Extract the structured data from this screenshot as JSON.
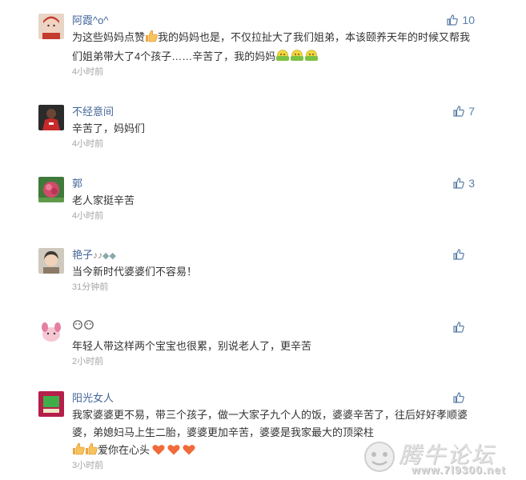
{
  "comments": [
    {
      "user": "阿霞^o^",
      "text_a": "为这些妈妈点赞",
      "text_b": "我的妈妈也是，不仅拉扯大了我们姐弟，本该颐养天年的时候又帮我们姐弟带大了4个孩子……辛苦了，我的妈妈",
      "time": "4小时前",
      "likes": "10",
      "avatar_colors": [
        "#f4d2c0",
        "#c43a2e"
      ]
    },
    {
      "user": "不经意间",
      "text": "辛苦了，妈妈们",
      "time": "4小时前",
      "likes": "7",
      "avatar_colors": [
        "#2b2b2b",
        "#c62a2a"
      ]
    },
    {
      "user": "郭",
      "text": "老人家挺辛苦",
      "time": "4小时前",
      "likes": "3",
      "avatar_colors": [
        "#3f7a3a",
        "#d04a6a"
      ]
    },
    {
      "user": "艳子",
      "text": "当今新时代婆婆们不容易！",
      "time": "31分钟前",
      "likes": "",
      "avatar_colors": [
        "#cfc9be",
        "#3e3a33"
      ]
    },
    {
      "user": "",
      "text": "年轻人带这样两个宝宝也很累，别说老人了，更辛苦",
      "time": "2小时前",
      "likes": "",
      "avatar_colors": [
        "#f6c8d4",
        "#e47fa0"
      ]
    },
    {
      "user": "阳光女人",
      "text_a": "我家婆婆更不易，带三个孩子，做一大家子九个人的饭，婆婆辛苦了，往后好好孝顺婆婆，弟媳妇马上生二胎，婆婆更加辛苦，婆婆是我家最大的顶梁柱",
      "text_b": "爱你在心头",
      "time": "3小时前",
      "likes": "",
      "avatar_colors": [
        "#b51f4a",
        "#3fae4a"
      ]
    }
  ],
  "watermark": {
    "brand": "腾牛论坛",
    "url": "www.7l9300.net"
  },
  "colors": {
    "name": "#406599",
    "text": "#333333",
    "time": "#a5a5a5",
    "like": "#5a7fa8",
    "heart": "#f06a3a"
  }
}
